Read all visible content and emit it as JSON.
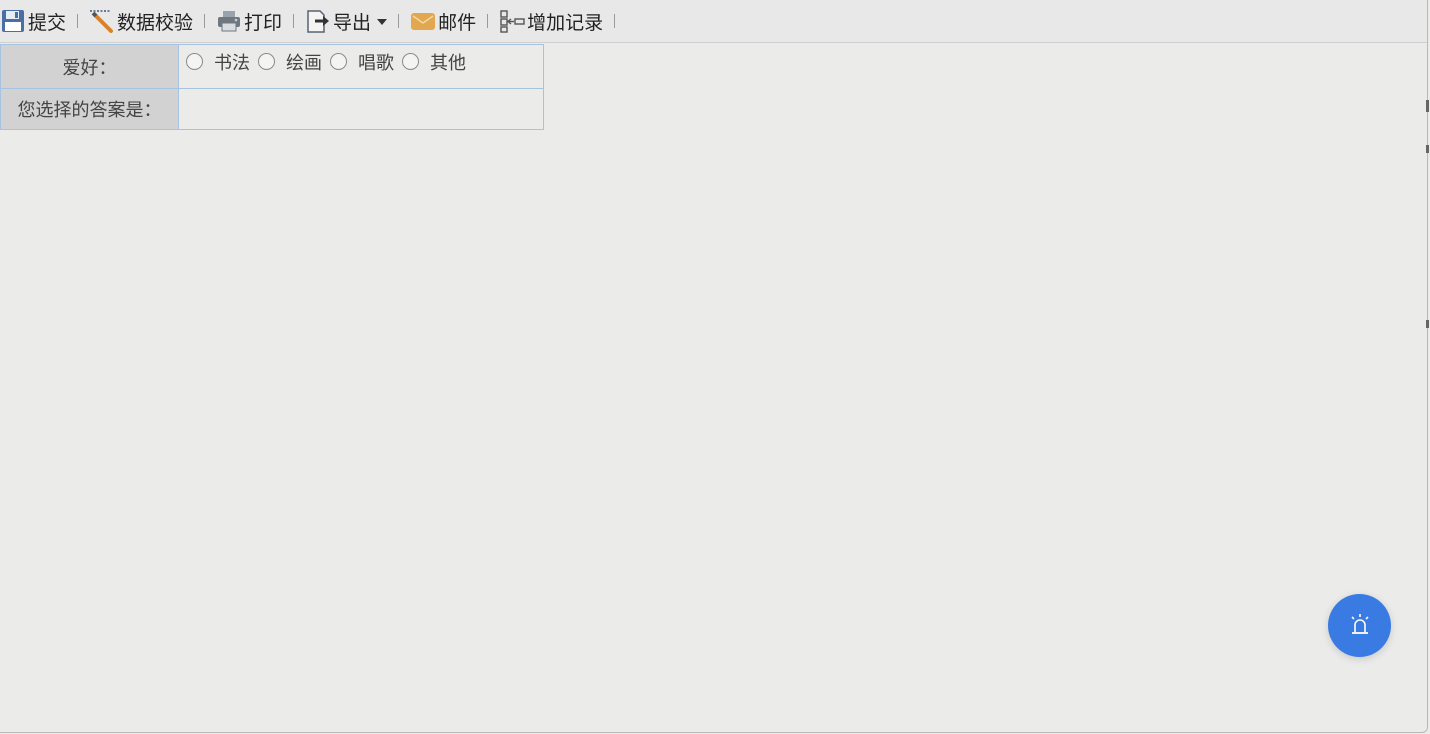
{
  "toolbar": {
    "items": [
      {
        "label": "提交",
        "icon": "save-icon"
      },
      {
        "label": "数据校验",
        "icon": "validate-icon"
      },
      {
        "label": "打印",
        "icon": "printer-icon"
      },
      {
        "label": "导出",
        "icon": "export-icon",
        "has_dropdown": true
      },
      {
        "label": "邮件",
        "icon": "mail-icon"
      },
      {
        "label": "增加记录",
        "icon": "add-record-icon"
      }
    ]
  },
  "form": {
    "hobby_label": "爱好：",
    "hobby_options": [
      "书法",
      "绘画",
      "唱歌",
      "其他"
    ],
    "answer_label": "您选择的答案是：",
    "answer_value": ""
  },
  "fab": {
    "icon": "alarm-icon"
  },
  "colors": {
    "accent": "#3a7be3",
    "label_bg": "#d2d2d2",
    "cell_border": "#a8c3e0",
    "page_bg": "#ebebea"
  }
}
